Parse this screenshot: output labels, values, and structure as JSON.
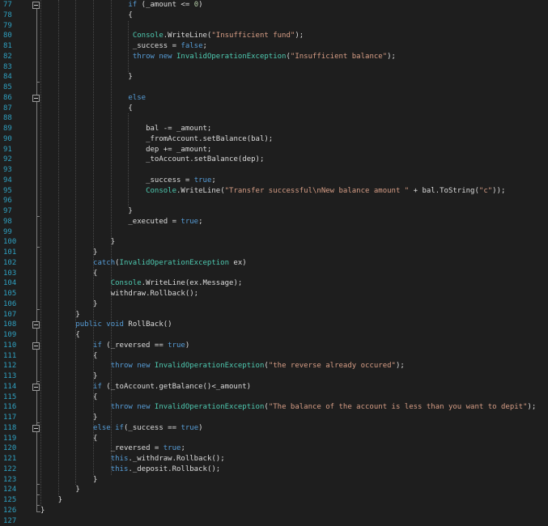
{
  "editor": {
    "app": "code-editor",
    "language": "csharp",
    "background": "#1e1e1e",
    "first_line_number": 77,
    "last_line_number": 127,
    "colors": {
      "keyword": "#569CD6",
      "type": "#4EC9B0",
      "string": "#D69D85",
      "number": "#B5CEA8",
      "plain": "#DCDCDC",
      "line_number": "#2FA0C0",
      "indent_guide": "#4a4a4a",
      "fold_margin": "#7f7f7f"
    },
    "fold_boxes": [
      77,
      86,
      108,
      110,
      114,
      118
    ],
    "fold_end_ticks": [
      84,
      97,
      100,
      106,
      113,
      117,
      123,
      124,
      125
    ],
    "fold_corner_line": 126,
    "indent_guides": [
      {
        "col": 0,
        "from": 77,
        "to": 125
      },
      {
        "col": 4,
        "from": 77,
        "to": 124
      },
      {
        "col": 8,
        "from": 77,
        "to": 123
      },
      {
        "col": 12,
        "from": 77,
        "to": 122
      },
      {
        "col": 16,
        "from": 77,
        "to": 122
      },
      {
        "col": 20,
        "from": 79,
        "to": 83
      },
      {
        "col": 20,
        "from": 88,
        "to": 96
      }
    ],
    "lines": [
      {
        "n": 77,
        "indent": 20,
        "tokens": [
          [
            "k",
            "if"
          ],
          [
            "p",
            " (_amount <= "
          ],
          [
            "n",
            "0"
          ],
          [
            "p",
            ")"
          ]
        ]
      },
      {
        "n": 78,
        "indent": 20,
        "tokens": [
          [
            "p",
            "{"
          ]
        ]
      },
      {
        "n": 79,
        "indent": 0,
        "tokens": []
      },
      {
        "n": 80,
        "indent": 21,
        "tokens": [
          [
            "t",
            "Console"
          ],
          [
            "p",
            ".WriteLine("
          ],
          [
            "s",
            "\"Insufficient fund\""
          ],
          [
            "p",
            ");"
          ]
        ]
      },
      {
        "n": 81,
        "indent": 21,
        "tokens": [
          [
            "p",
            "_success = "
          ],
          [
            "k",
            "false"
          ],
          [
            "p",
            ";"
          ]
        ]
      },
      {
        "n": 82,
        "indent": 21,
        "tokens": [
          [
            "k",
            "throw"
          ],
          [
            "p",
            " "
          ],
          [
            "k",
            "new"
          ],
          [
            "p",
            " "
          ],
          [
            "t",
            "InvalidOperationException"
          ],
          [
            "p",
            "("
          ],
          [
            "s",
            "\"Insufficient balance\""
          ],
          [
            "p",
            ");"
          ]
        ]
      },
      {
        "n": 83,
        "indent": 0,
        "tokens": []
      },
      {
        "n": 84,
        "indent": 20,
        "tokens": [
          [
            "p",
            "}"
          ]
        ]
      },
      {
        "n": 85,
        "indent": 0,
        "tokens": []
      },
      {
        "n": 86,
        "indent": 20,
        "tokens": [
          [
            "k",
            "else"
          ]
        ]
      },
      {
        "n": 87,
        "indent": 20,
        "tokens": [
          [
            "p",
            "{"
          ]
        ]
      },
      {
        "n": 88,
        "indent": 0,
        "tokens": []
      },
      {
        "n": 89,
        "indent": 24,
        "tokens": [
          [
            "p",
            "bal -= _amount;"
          ]
        ]
      },
      {
        "n": 90,
        "indent": 24,
        "tokens": [
          [
            "p",
            "_fromAccount.setBalance(bal);"
          ]
        ]
      },
      {
        "n": 91,
        "indent": 24,
        "tokens": [
          [
            "p",
            "dep += _amount;"
          ]
        ]
      },
      {
        "n": 92,
        "indent": 24,
        "tokens": [
          [
            "p",
            "_toAccount.setBalance(dep);"
          ]
        ]
      },
      {
        "n": 93,
        "indent": 0,
        "tokens": []
      },
      {
        "n": 94,
        "indent": 24,
        "tokens": [
          [
            "p",
            "_success = "
          ],
          [
            "k",
            "true"
          ],
          [
            "p",
            ";"
          ]
        ]
      },
      {
        "n": 95,
        "indent": 24,
        "tokens": [
          [
            "t",
            "Console"
          ],
          [
            "p",
            ".WriteLine("
          ],
          [
            "s",
            "\"Transfer successful\\nNew balance amount \""
          ],
          [
            "p",
            " + bal.ToString("
          ],
          [
            "s",
            "\"c\""
          ],
          [
            "p",
            "));"
          ]
        ]
      },
      {
        "n": 96,
        "indent": 0,
        "tokens": []
      },
      {
        "n": 97,
        "indent": 20,
        "tokens": [
          [
            "p",
            "}"
          ]
        ]
      },
      {
        "n": 98,
        "indent": 20,
        "tokens": [
          [
            "p",
            "_executed = "
          ],
          [
            "k",
            "true"
          ],
          [
            "p",
            ";"
          ]
        ]
      },
      {
        "n": 99,
        "indent": 0,
        "tokens": []
      },
      {
        "n": 100,
        "indent": 16,
        "tokens": [
          [
            "p",
            "}"
          ]
        ]
      },
      {
        "n": 101,
        "indent": 12,
        "tokens": [
          [
            "p",
            "}"
          ]
        ]
      },
      {
        "n": 102,
        "indent": 12,
        "tokens": [
          [
            "k",
            "catch"
          ],
          [
            "p",
            "("
          ],
          [
            "t",
            "InvalidOperationException"
          ],
          [
            "p",
            " ex)"
          ]
        ]
      },
      {
        "n": 103,
        "indent": 12,
        "tokens": [
          [
            "p",
            "{"
          ]
        ]
      },
      {
        "n": 104,
        "indent": 16,
        "tokens": [
          [
            "t",
            "Console"
          ],
          [
            "p",
            ".WriteLine(ex.Message);"
          ]
        ]
      },
      {
        "n": 105,
        "indent": 16,
        "tokens": [
          [
            "p",
            "withdraw.Rollback();"
          ]
        ]
      },
      {
        "n": 106,
        "indent": 12,
        "tokens": [
          [
            "p",
            "}"
          ]
        ]
      },
      {
        "n": 107,
        "indent": 8,
        "tokens": [
          [
            "p",
            "}"
          ]
        ]
      },
      {
        "n": 108,
        "indent": 8,
        "tokens": [
          [
            "k",
            "public"
          ],
          [
            "p",
            " "
          ],
          [
            "k",
            "void"
          ],
          [
            "p",
            " RollBack()"
          ]
        ]
      },
      {
        "n": 109,
        "indent": 8,
        "tokens": [
          [
            "p",
            "{"
          ]
        ]
      },
      {
        "n": 110,
        "indent": 12,
        "tokens": [
          [
            "k",
            "if"
          ],
          [
            "p",
            " (_reversed == "
          ],
          [
            "k",
            "true"
          ],
          [
            "p",
            ")"
          ]
        ]
      },
      {
        "n": 111,
        "indent": 12,
        "tokens": [
          [
            "p",
            "{"
          ]
        ]
      },
      {
        "n": 112,
        "indent": 16,
        "tokens": [
          [
            "k",
            "throw"
          ],
          [
            "p",
            " "
          ],
          [
            "k",
            "new"
          ],
          [
            "p",
            " "
          ],
          [
            "t",
            "InvalidOperationException"
          ],
          [
            "p",
            "("
          ],
          [
            "s",
            "\"the reverse already occured\""
          ],
          [
            "p",
            ");"
          ]
        ]
      },
      {
        "n": 113,
        "indent": 12,
        "tokens": [
          [
            "p",
            "}"
          ]
        ]
      },
      {
        "n": 114,
        "indent": 12,
        "tokens": [
          [
            "k",
            "if"
          ],
          [
            "p",
            " (_toAccount.getBalance()<_amount)"
          ]
        ]
      },
      {
        "n": 115,
        "indent": 12,
        "tokens": [
          [
            "p",
            "{"
          ]
        ]
      },
      {
        "n": 116,
        "indent": 16,
        "tokens": [
          [
            "k",
            "throw"
          ],
          [
            "p",
            " "
          ],
          [
            "k",
            "new"
          ],
          [
            "p",
            " "
          ],
          [
            "t",
            "InvalidOperationException"
          ],
          [
            "p",
            "("
          ],
          [
            "s",
            "\"The balance of the account is less than you want to depit\""
          ],
          [
            "p",
            ");"
          ]
        ]
      },
      {
        "n": 117,
        "indent": 12,
        "tokens": [
          [
            "p",
            "}"
          ]
        ]
      },
      {
        "n": 118,
        "indent": 12,
        "tokens": [
          [
            "k",
            "else"
          ],
          [
            "p",
            " "
          ],
          [
            "k",
            "if"
          ],
          [
            "p",
            "(_success == "
          ],
          [
            "k",
            "true"
          ],
          [
            "p",
            ")"
          ]
        ]
      },
      {
        "n": 119,
        "indent": 12,
        "tokens": [
          [
            "p",
            "{"
          ]
        ]
      },
      {
        "n": 120,
        "indent": 16,
        "tokens": [
          [
            "p",
            "_reversed = "
          ],
          [
            "k",
            "true"
          ],
          [
            "p",
            ";"
          ]
        ]
      },
      {
        "n": 121,
        "indent": 16,
        "tokens": [
          [
            "k",
            "this"
          ],
          [
            "p",
            "._withdraw.Rollback();"
          ]
        ]
      },
      {
        "n": 122,
        "indent": 16,
        "tokens": [
          [
            "k",
            "this"
          ],
          [
            "p",
            "._deposit.Rollback();"
          ]
        ]
      },
      {
        "n": 123,
        "indent": 12,
        "tokens": [
          [
            "p",
            "}"
          ]
        ]
      },
      {
        "n": 124,
        "indent": 8,
        "tokens": [
          [
            "p",
            "}"
          ]
        ]
      },
      {
        "n": 125,
        "indent": 4,
        "tokens": [
          [
            "p",
            "}"
          ]
        ]
      },
      {
        "n": 126,
        "indent": 0,
        "tokens": [
          [
            "p",
            "}"
          ]
        ]
      },
      {
        "n": 127,
        "indent": 0,
        "tokens": []
      }
    ]
  }
}
